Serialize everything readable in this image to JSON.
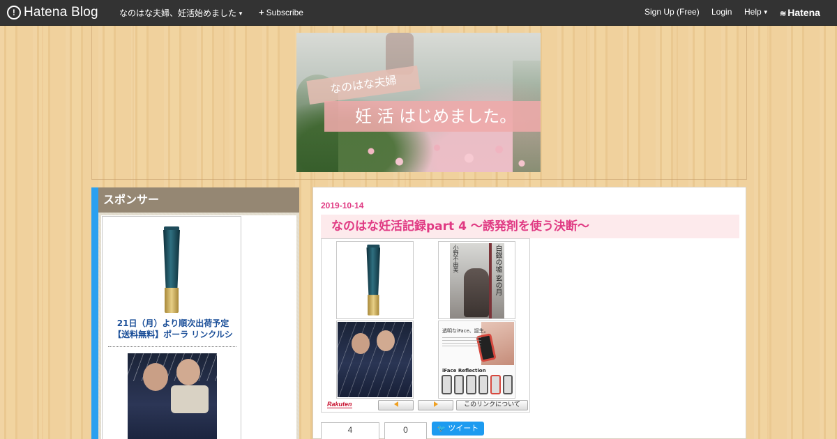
{
  "navbar": {
    "logo_text": "Hatena Blog",
    "blog_name": "なのはな夫婦、妊活始めました",
    "subscribe": "Subscribe",
    "sign_up": "Sign Up (Free)",
    "login": "Login",
    "help": "Help",
    "hatena": "Hatena"
  },
  "banner": {
    "line1": "なのはな夫婦",
    "line2": "妊 活 はじめました。"
  },
  "sidebar": {
    "title": "スポンサー",
    "ad_text_line1": "21日（月）より順次出荷予定",
    "ad_text_line2": "【送料無料】ポーラ リンクルシ"
  },
  "post": {
    "date": "2019-10-14",
    "title": "なのはな妊活記録part 4 ～誘発剤を使う決断～"
  },
  "rakuten_widget": {
    "brand": "Rakuten",
    "book_title": "白銀の墟 玄の月",
    "book_author": "小野不由美",
    "iface_tagline": "透明なiFace、誕生。",
    "iface_logo": "iFace Reflection",
    "about_link": "このリンクについて"
  },
  "share": {
    "hatena_count": "4",
    "facebook_count": "0",
    "tweet": "ツイート"
  },
  "colors": {
    "accent_pink": "#e03a83",
    "link_blue": "#1a4e98",
    "sidebar_stripe": "#2aa0f0",
    "sidebar_header": "#958773",
    "navbar": "#333333"
  }
}
